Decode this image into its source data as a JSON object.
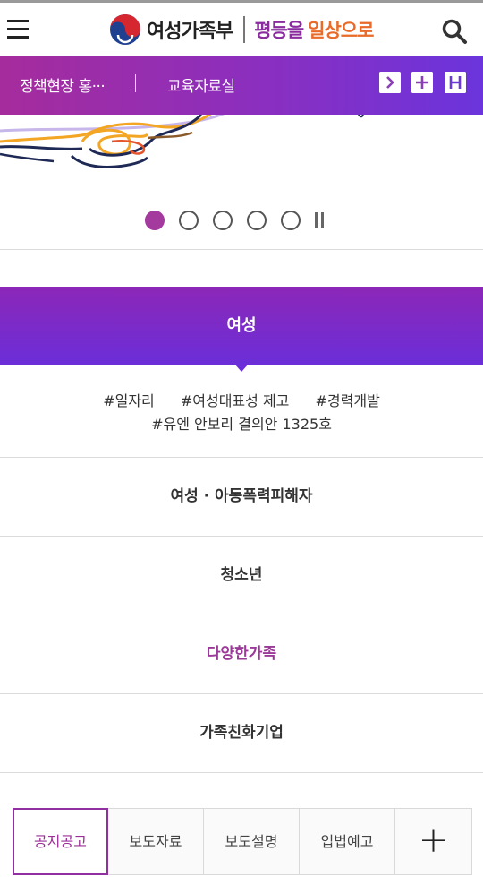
{
  "header": {
    "org_name": "여성가족부",
    "slogan_part1": "평등을",
    "slogan_part2": "일상으로"
  },
  "subbar": {
    "link1": "정책현장 홍···",
    "link2": "교육자료실"
  },
  "slider": {
    "total_slides": 5,
    "active_index": 1
  },
  "category": {
    "title": "여성",
    "tags_line1": [
      "#일자리",
      "#여성대표성 제고",
      "#경력개발"
    ],
    "tags_line2": [
      "#유엔 안보리 결의안 1325호"
    ],
    "items": [
      "여성 · 아동폭력피해자",
      "청소년",
      "다양한가족",
      "가족친화기업"
    ]
  },
  "tabs": {
    "items": [
      "공지공고",
      "보도자료",
      "보도설명",
      "입법예고"
    ],
    "active": "공지공고",
    "plus_label": "+"
  },
  "colors": {
    "purple": "#8a2fc0",
    "accent": "#9b3a98",
    "orange": "#e86b2a"
  }
}
